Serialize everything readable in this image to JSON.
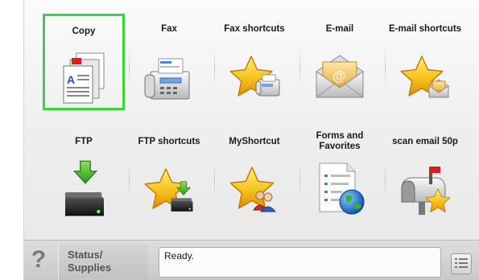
{
  "home": {
    "row1": [
      {
        "label": "Copy",
        "icon": "copy-icon"
      },
      {
        "label": "Fax",
        "icon": "fax-icon"
      },
      {
        "label": "Fax shortcuts",
        "icon": "fax-shortcuts-icon"
      },
      {
        "label": "E-mail",
        "icon": "email-icon"
      },
      {
        "label": "E-mail shortcuts",
        "icon": "email-shortcuts-icon"
      }
    ],
    "row2": [
      {
        "label": "FTP",
        "icon": "ftp-icon"
      },
      {
        "label": "FTP shortcuts",
        "icon": "ftp-shortcuts-icon"
      },
      {
        "label": "MyShortcut",
        "icon": "myshortcut-icon"
      },
      {
        "label": "Forms and Favorites",
        "icon": "forms-favorites-icon"
      },
      {
        "label": "scan email 50p",
        "icon": "scan-email-icon"
      }
    ],
    "selected": "Copy"
  },
  "statusbar": {
    "help_icon": "?",
    "status_line1": "Status/",
    "status_line2": "Supplies",
    "message": "Ready.",
    "menu_icon": "list-icon"
  },
  "colors": {
    "selection": "#3ed23e",
    "star": "#f7c21b",
    "download_arrow": "#3fae2a"
  }
}
